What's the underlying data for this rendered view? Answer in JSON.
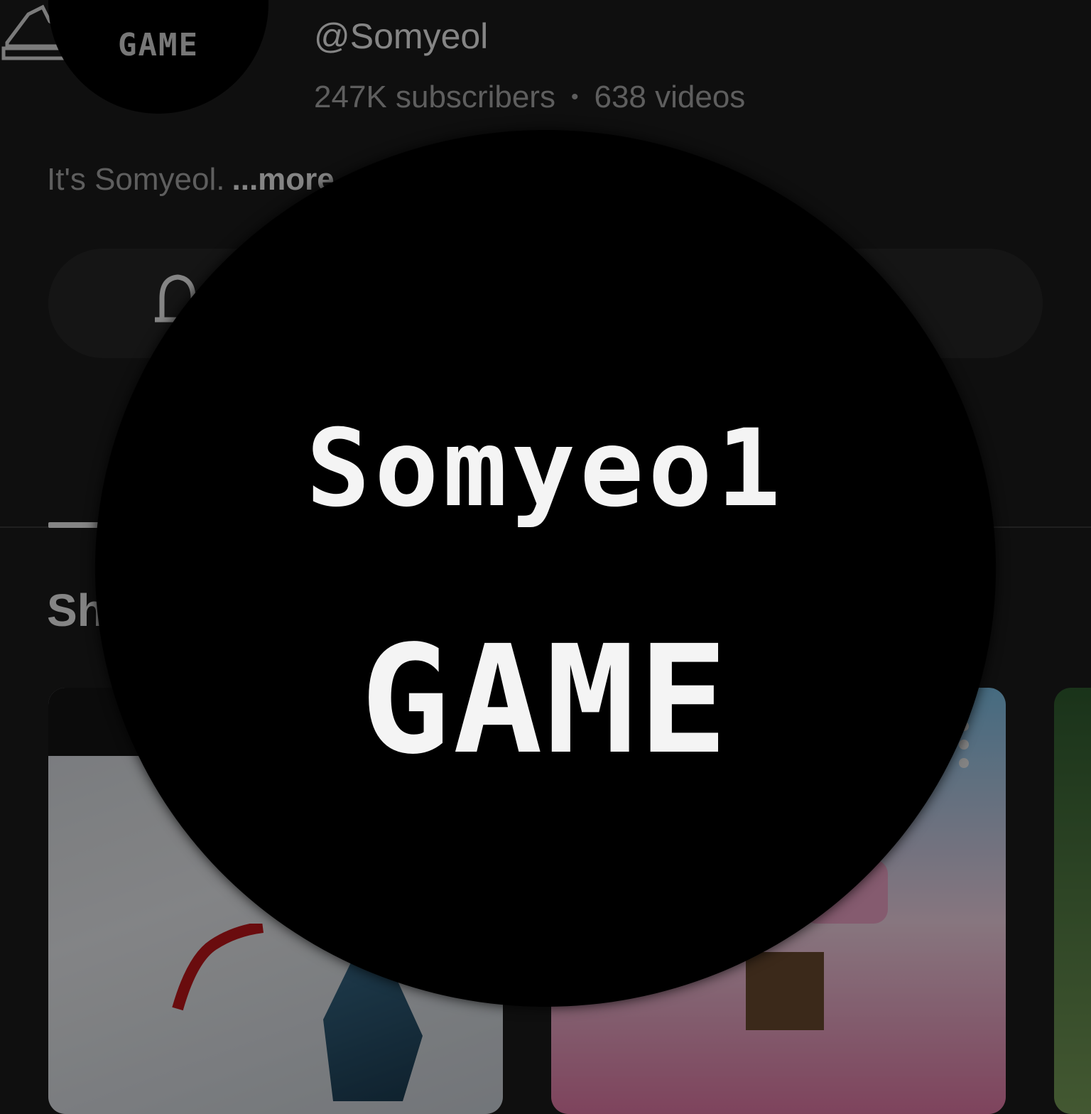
{
  "channel": {
    "avatar_text": "GAME",
    "handle": "@Somyeol",
    "subscribers": "247K subscribers",
    "separator": "•",
    "videos": "638 videos",
    "description": "It's Somyeol.",
    "more_label": "...more"
  },
  "section": {
    "title_partial": "Sh"
  },
  "zoom_overlay": {
    "line1": "Somyeo1",
    "line2": "GAME"
  },
  "colors": {
    "background": "#0f0f0f",
    "secondary_text": "#aaaaaa",
    "pill": "#272727"
  }
}
